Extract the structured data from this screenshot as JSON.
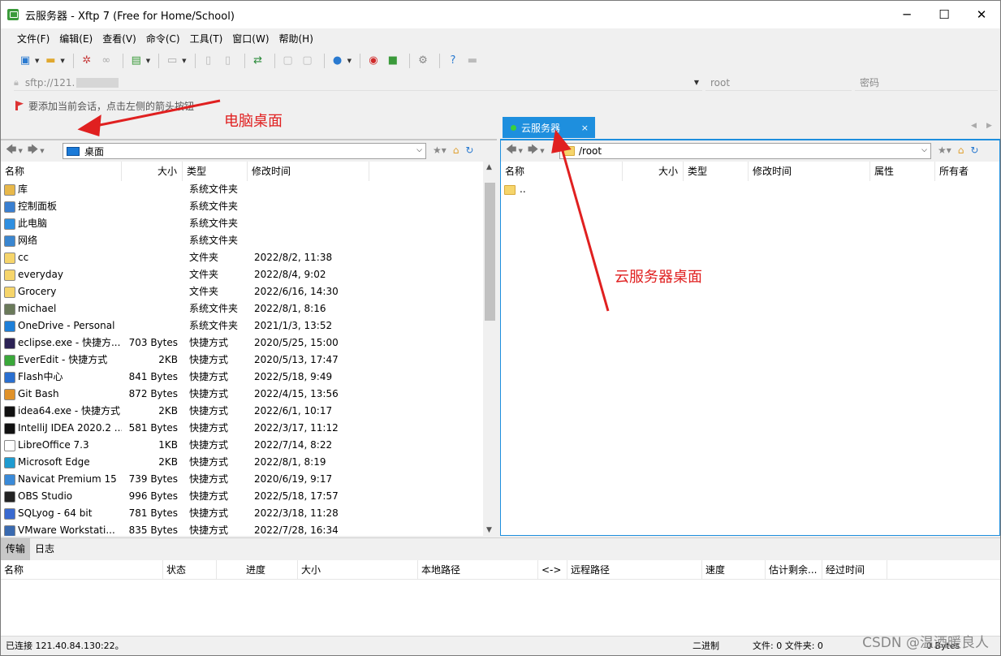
{
  "window": {
    "title": "云服务器 - Xftp 7 (Free for Home/School)",
    "min": "─",
    "max": "☐",
    "close": "✕"
  },
  "menu": [
    "文件(F)",
    "编辑(E)",
    "查看(V)",
    "命令(C)",
    "工具(T)",
    "窗口(W)",
    "帮助(H)"
  ],
  "address": {
    "value": "sftp://121.",
    "user_placeholder": "root",
    "pass_placeholder": "密码"
  },
  "hint": "要添加当前会话，点击左侧的箭头按钮",
  "tabs": {
    "left": "桌面",
    "right": "云服务器",
    "close": "×"
  },
  "left_pane": {
    "path": "桌面",
    "headers": [
      "名称",
      "大小",
      "类型",
      "修改时间"
    ],
    "files": [
      {
        "name": "库",
        "size": "",
        "type": "系统文件夹",
        "time": "",
        "icon": "library-icon",
        "color": "#e8b84a"
      },
      {
        "name": "控制面板",
        "size": "",
        "type": "系统文件夹",
        "time": "",
        "icon": "control-panel-icon",
        "color": "#3a7fd0"
      },
      {
        "name": "此电脑",
        "size": "",
        "type": "系统文件夹",
        "time": "",
        "icon": "computer-icon",
        "color": "#2f8fe0"
      },
      {
        "name": "网络",
        "size": "",
        "type": "系统文件夹",
        "time": "",
        "icon": "network-icon",
        "color": "#3a86d0"
      },
      {
        "name": "cc",
        "size": "",
        "type": "文件夹",
        "time": "2022/8/2, 11:38",
        "icon": "folder-icon",
        "color": "#f6d56b"
      },
      {
        "name": "everyday",
        "size": "",
        "type": "文件夹",
        "time": "2022/8/4, 9:02",
        "icon": "folder-icon",
        "color": "#f6d56b"
      },
      {
        "name": "Grocery",
        "size": "",
        "type": "文件夹",
        "time": "2022/6/16, 14:30",
        "icon": "folder-icon",
        "color": "#f6d56b"
      },
      {
        "name": "michael",
        "size": "",
        "type": "系统文件夹",
        "time": "2022/8/1, 8:16",
        "icon": "user-icon",
        "color": "#6a7a5a"
      },
      {
        "name": "OneDrive - Personal",
        "size": "",
        "type": "系统文件夹",
        "time": "2021/1/3, 13:52",
        "icon": "cloud-icon",
        "color": "#1e7fd8"
      },
      {
        "name": "eclipse.exe - 快捷方...",
        "size": "703 Bytes",
        "type": "快捷方式",
        "time": "2020/5/25, 15:00",
        "icon": "eclipse-icon",
        "color": "#2c2255"
      },
      {
        "name": "EverEdit - 快捷方式",
        "size": "2KB",
        "type": "快捷方式",
        "time": "2020/5/13, 17:47",
        "icon": "everedit-icon",
        "color": "#3aa83a"
      },
      {
        "name": "Flash中心",
        "size": "841 Bytes",
        "type": "快捷方式",
        "time": "2022/5/18, 9:49",
        "icon": "flash-icon",
        "color": "#2a6fd0"
      },
      {
        "name": "Git Bash",
        "size": "872 Bytes",
        "type": "快捷方式",
        "time": "2022/4/15, 13:56",
        "icon": "git-icon",
        "color": "#e0922a"
      },
      {
        "name": "idea64.exe - 快捷方式",
        "size": "2KB",
        "type": "快捷方式",
        "time": "2022/6/1, 10:17",
        "icon": "idea-icon",
        "color": "#111111"
      },
      {
        "name": "IntelliJ IDEA 2020.2 ...",
        "size": "581 Bytes",
        "type": "快捷方式",
        "time": "2022/3/17, 11:12",
        "icon": "idea-icon",
        "color": "#111111"
      },
      {
        "name": "LibreOffice 7.3",
        "size": "1KB",
        "type": "快捷方式",
        "time": "2022/7/14, 8:22",
        "icon": "libreoffice-icon",
        "color": "#ffffff"
      },
      {
        "name": "Microsoft Edge",
        "size": "2KB",
        "type": "快捷方式",
        "time": "2022/8/1, 8:19",
        "icon": "edge-icon",
        "color": "#1f9bd0"
      },
      {
        "name": "Navicat Premium 15",
        "size": "739 Bytes",
        "type": "快捷方式",
        "time": "2020/6/19, 9:17",
        "icon": "navicat-icon",
        "color": "#3a8ad8"
      },
      {
        "name": "OBS Studio",
        "size": "996 Bytes",
        "type": "快捷方式",
        "time": "2022/5/18, 17:57",
        "icon": "obs-icon",
        "color": "#222222"
      },
      {
        "name": "SQLyog - 64 bit",
        "size": "781 Bytes",
        "type": "快捷方式",
        "time": "2022/3/18, 11:28",
        "icon": "sqlyog-icon",
        "color": "#3a6ad0"
      },
      {
        "name": "VMware Workstati...",
        "size": "835 Bytes",
        "type": "快捷方式",
        "time": "2022/7/28, 16:34",
        "icon": "vmware-icon",
        "color": "#3a6ab0"
      }
    ]
  },
  "right_pane": {
    "path": "/root",
    "headers": [
      "名称",
      "大小",
      "类型",
      "修改时间",
      "属性",
      "所有者"
    ],
    "files": [
      {
        "name": ".."
      }
    ]
  },
  "bottom": {
    "tabs": [
      "传输",
      "日志"
    ],
    "headers": [
      "名称",
      "状态",
      "进度",
      "大小",
      "本地路径",
      "<->",
      "远程路径",
      "速度",
      "估计剩余...",
      "经过时间"
    ]
  },
  "status": {
    "connected": "已连接 121.40.84.130:22。",
    "mode": "二进制",
    "files": "文件: 0  文件夹: 0",
    "bytes": "0 Bytes"
  },
  "annotations": {
    "left": "电脑桌面",
    "right": "云服务器桌面"
  },
  "watermark": "CSDN @温酒暖良人"
}
